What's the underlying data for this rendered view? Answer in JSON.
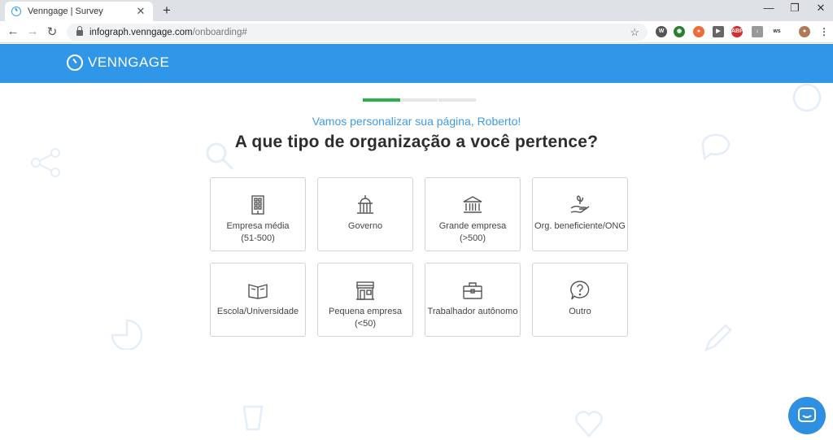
{
  "browser": {
    "tab_title": "Venngage | Survey",
    "tab_close": "✕",
    "new_tab": "+",
    "url_host": "infograph.venngage.com",
    "url_path": "/onboarding#",
    "window_minimize": "—",
    "window_restore": "❐",
    "window_close": "✕"
  },
  "header": {
    "brand": "VENNGAGE",
    "color": "#2f96e8"
  },
  "progress": {
    "total_steps": 3,
    "completed_steps": 1,
    "color": "#26b34a"
  },
  "survey": {
    "greeting": "Vamos personalizar sua página, Roberto!",
    "question": "A que tipo de organização  a você pertence?",
    "options": [
      {
        "label": "Empresa média\n(51-500)",
        "icon": "building-icon"
      },
      {
        "label": "Governo",
        "icon": "capitol-icon"
      },
      {
        "label": "Grande empresa\n(>500)",
        "icon": "bank-icon"
      },
      {
        "label": "Org. beneficiente/ONG",
        "icon": "hand-plant-icon"
      },
      {
        "label": "Escola/Universidade",
        "icon": "open-book-icon"
      },
      {
        "label": "Pequena empresa\n(<50)",
        "icon": "storefront-icon"
      },
      {
        "label": "Trabalhador autônomo",
        "icon": "briefcase-icon"
      },
      {
        "label": "Outro",
        "icon": "question-bubble-icon"
      }
    ]
  },
  "extensions": {
    "abp_label": "ABP",
    "ws_label": "ws"
  }
}
